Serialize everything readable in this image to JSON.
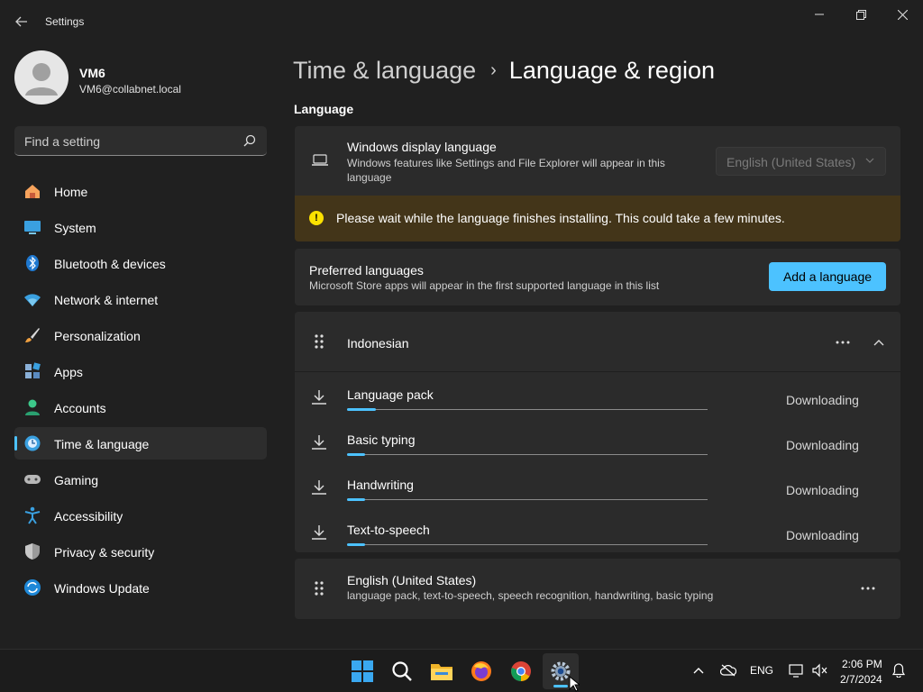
{
  "window": {
    "title": "Settings"
  },
  "profile": {
    "name": "VM6",
    "email": "VM6@collabnet.local"
  },
  "search": {
    "placeholder": "Find a setting"
  },
  "sidebar": {
    "items": [
      {
        "label": "Home",
        "icon": "home-icon",
        "active": false
      },
      {
        "label": "System",
        "icon": "system-icon",
        "active": false
      },
      {
        "label": "Bluetooth & devices",
        "icon": "bluetooth-icon",
        "active": false
      },
      {
        "label": "Network & internet",
        "icon": "network-icon",
        "active": false
      },
      {
        "label": "Personalization",
        "icon": "personalization-icon",
        "active": false
      },
      {
        "label": "Apps",
        "icon": "apps-icon",
        "active": false
      },
      {
        "label": "Accounts",
        "icon": "accounts-icon",
        "active": false
      },
      {
        "label": "Time & language",
        "icon": "time-language-icon",
        "active": true
      },
      {
        "label": "Gaming",
        "icon": "gaming-icon",
        "active": false
      },
      {
        "label": "Accessibility",
        "icon": "accessibility-icon",
        "active": false
      },
      {
        "label": "Privacy & security",
        "icon": "shield-icon",
        "active": false
      },
      {
        "label": "Windows Update",
        "icon": "update-icon",
        "active": false
      }
    ]
  },
  "breadcrumb": {
    "parent": "Time & language",
    "separator": "›",
    "current": "Language & region"
  },
  "language_section": {
    "title": "Language",
    "display_language": {
      "title": "Windows display language",
      "description": "Windows features like Settings and File Explorer will appear in this language",
      "selected": "English (United States)"
    },
    "warning": "Please wait while the language finishes installing. This could take a few minutes.",
    "preferred": {
      "title": "Preferred languages",
      "description": "Microsoft Store apps will appear in the first supported language in this list",
      "add_button": "Add a language"
    },
    "indonesian": {
      "name": "Indonesian",
      "features": [
        {
          "name": "Language pack",
          "status": "Downloading",
          "progress": 0.08
        },
        {
          "name": "Basic typing",
          "status": "Downloading",
          "progress": 0.05
        },
        {
          "name": "Handwriting",
          "status": "Downloading",
          "progress": 0.05
        },
        {
          "name": "Text-to-speech",
          "status": "Downloading",
          "progress": 0.05
        }
      ]
    },
    "english": {
      "name": "English (United States)",
      "description": "language pack, text-to-speech, speech recognition, handwriting, basic typing"
    }
  },
  "taskbar": {
    "tray_language": "ENG",
    "time": "2:06 PM",
    "date": "2/7/2024"
  },
  "colors": {
    "accent": "#4cc2ff",
    "warning_bg": "#433519",
    "warning_icon": "#fce100"
  }
}
